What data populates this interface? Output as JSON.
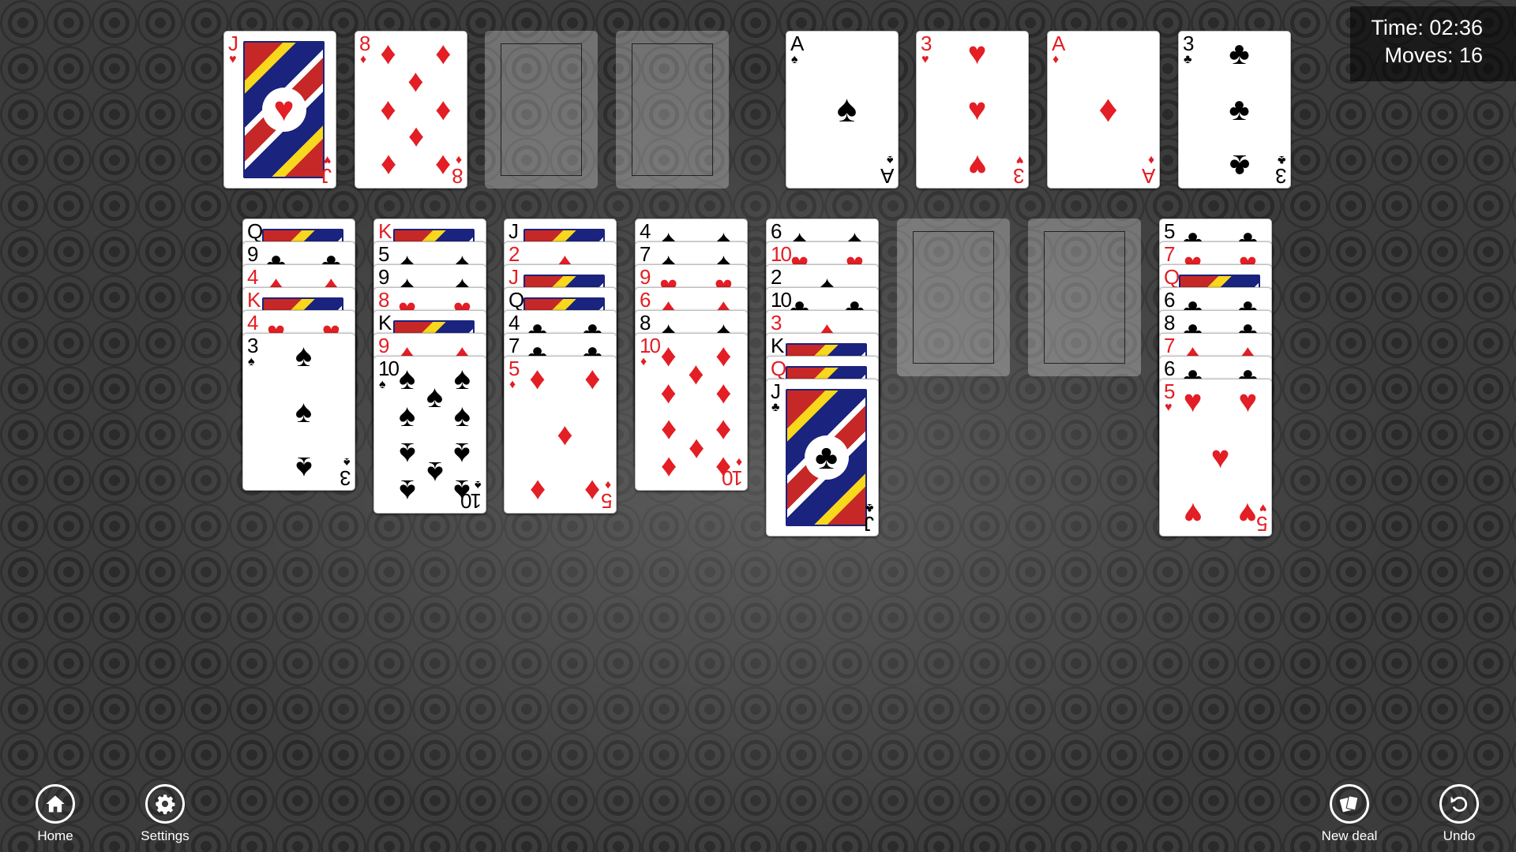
{
  "hud": {
    "time_label": "Time: 02:36",
    "moves_label": "Moves: 16"
  },
  "colors": {
    "red_suit": "#e31e24",
    "black_suit": "#000000"
  },
  "free_cells": [
    {
      "rank": "J",
      "suit": "heart"
    },
    {
      "rank": "8",
      "suit": "diamond"
    },
    null,
    null
  ],
  "foundations": [
    {
      "rank": "A",
      "suit": "spade"
    },
    {
      "rank": "3",
      "suit": "heart"
    },
    {
      "rank": "A",
      "suit": "diamond"
    },
    {
      "rank": "3",
      "suit": "club"
    }
  ],
  "tableau": [
    [
      {
        "rank": "Q",
        "suit": "club"
      },
      {
        "rank": "9",
        "suit": "club"
      },
      {
        "rank": "4",
        "suit": "diamond"
      },
      {
        "rank": "K",
        "suit": "diamond"
      },
      {
        "rank": "4",
        "suit": "heart"
      },
      {
        "rank": "3",
        "suit": "spade"
      }
    ],
    [
      {
        "rank": "K",
        "suit": "heart"
      },
      {
        "rank": "5",
        "suit": "spade"
      },
      {
        "rank": "9",
        "suit": "spade"
      },
      {
        "rank": "8",
        "suit": "heart"
      },
      {
        "rank": "K",
        "suit": "spade"
      },
      {
        "rank": "9",
        "suit": "diamond"
      },
      {
        "rank": "10",
        "suit": "spade"
      }
    ],
    [
      {
        "rank": "J",
        "suit": "spade"
      },
      {
        "rank": "2",
        "suit": "diamond"
      },
      {
        "rank": "J",
        "suit": "diamond"
      },
      {
        "rank": "Q",
        "suit": "spade"
      },
      {
        "rank": "4",
        "suit": "club"
      },
      {
        "rank": "7",
        "suit": "club"
      },
      {
        "rank": "5",
        "suit": "diamond"
      }
    ],
    [
      {
        "rank": "4",
        "suit": "spade"
      },
      {
        "rank": "7",
        "suit": "spade"
      },
      {
        "rank": "9",
        "suit": "heart"
      },
      {
        "rank": "6",
        "suit": "diamond"
      },
      {
        "rank": "8",
        "suit": "spade"
      },
      {
        "rank": "10",
        "suit": "diamond"
      }
    ],
    [
      {
        "rank": "6",
        "suit": "spade"
      },
      {
        "rank": "10",
        "suit": "heart"
      },
      {
        "rank": "2",
        "suit": "spade"
      },
      {
        "rank": "10",
        "suit": "club"
      },
      {
        "rank": "3",
        "suit": "diamond"
      },
      {
        "rank": "K",
        "suit": "club"
      },
      {
        "rank": "Q",
        "suit": "heart"
      },
      {
        "rank": "J",
        "suit": "club"
      }
    ],
    [],
    [],
    [
      {
        "rank": "5",
        "suit": "club"
      },
      {
        "rank": "7",
        "suit": "heart"
      },
      {
        "rank": "Q",
        "suit": "diamond"
      },
      {
        "rank": "6",
        "suit": "club"
      },
      {
        "rank": "8",
        "suit": "club"
      },
      {
        "rank": "7",
        "suit": "diamond"
      },
      {
        "rank": "6",
        "suit": "club"
      },
      {
        "rank": "5",
        "suit": "heart"
      }
    ]
  ],
  "appbar": {
    "home_label": "Home",
    "settings_label": "Settings",
    "new_deal_label": "New deal",
    "undo_label": "Undo"
  }
}
